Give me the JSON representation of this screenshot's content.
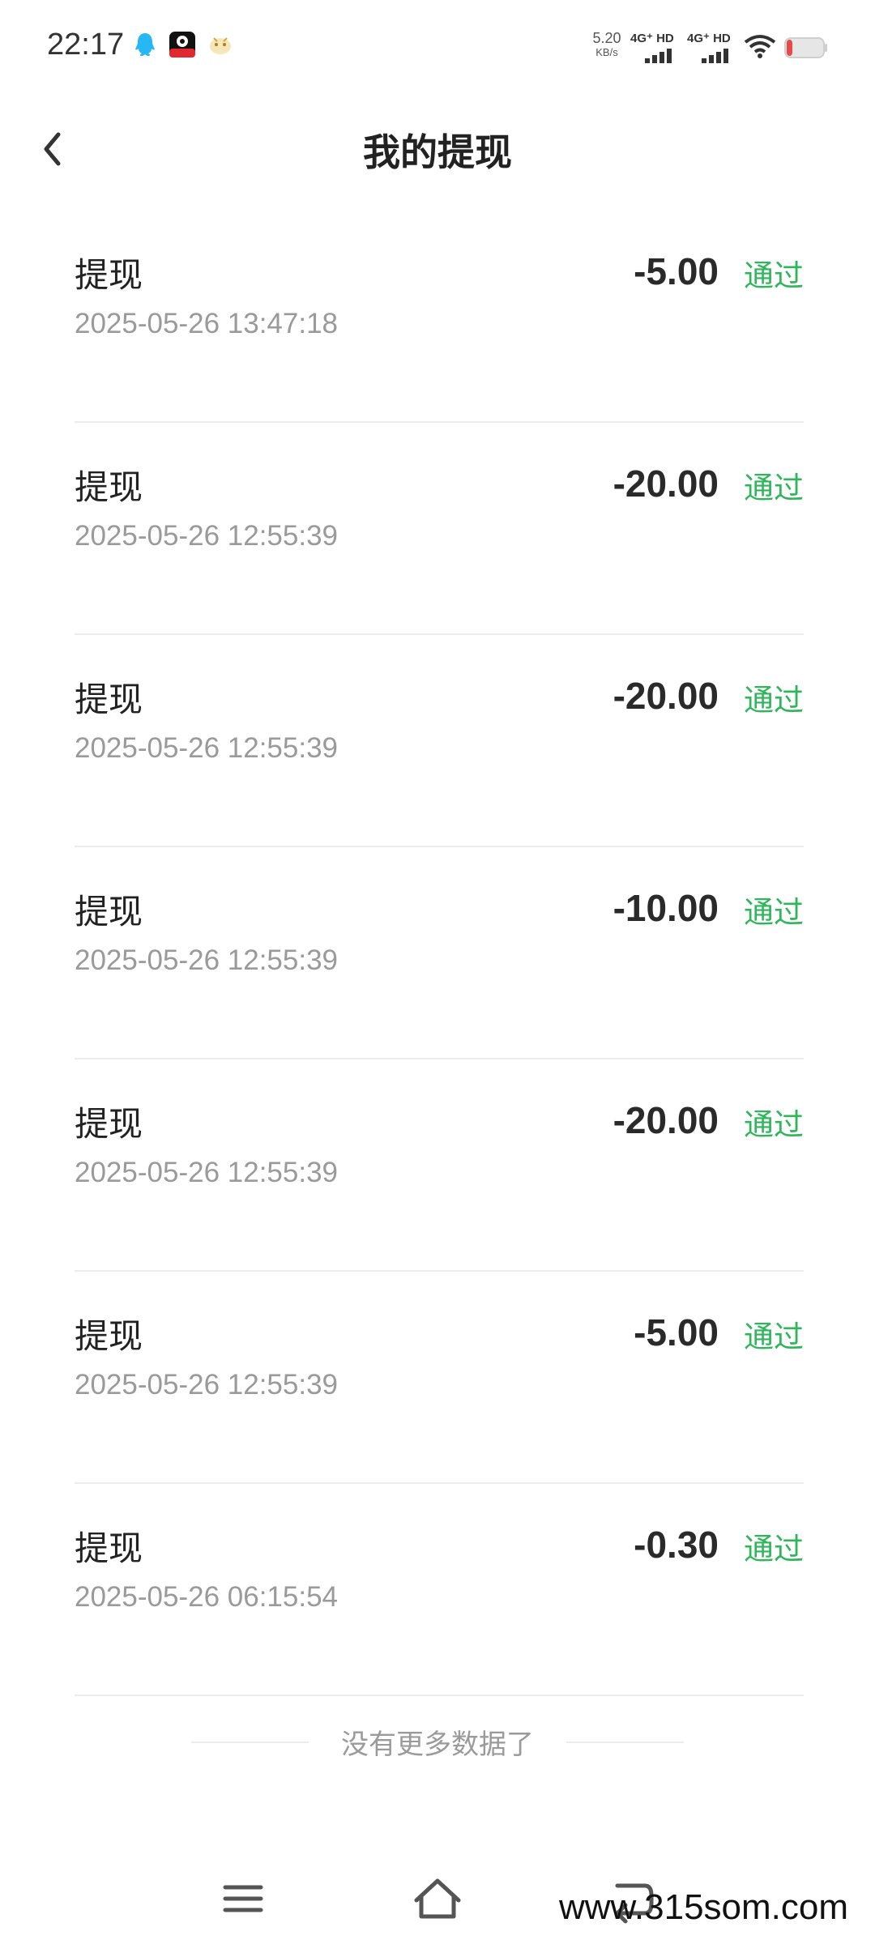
{
  "status_bar": {
    "time": "22:17",
    "net_speed_value": "5.20",
    "net_speed_unit": "KB/s",
    "signal1_label": "4G⁺ HD",
    "signal2_label": "4G⁺ HD",
    "icons": [
      "qq-icon",
      "app-icon",
      "app-icon-2",
      "signal-icon",
      "wifi-icon",
      "battery-icon"
    ],
    "battery_color": "#e84a4a"
  },
  "header": {
    "title": "我的提现",
    "back_icon": "chevron-left-icon"
  },
  "records": [
    {
      "title": "提现",
      "date": "2025-05-26 13:47:18",
      "amount": "-5.00",
      "status": "通过"
    },
    {
      "title": "提现",
      "date": "2025-05-26 12:55:39",
      "amount": "-20.00",
      "status": "通过"
    },
    {
      "title": "提现",
      "date": "2025-05-26 12:55:39",
      "amount": "-20.00",
      "status": "通过"
    },
    {
      "title": "提现",
      "date": "2025-05-26 12:55:39",
      "amount": "-10.00",
      "status": "通过"
    },
    {
      "title": "提现",
      "date": "2025-05-26 12:55:39",
      "amount": "-20.00",
      "status": "通过"
    },
    {
      "title": "提现",
      "date": "2025-05-26 12:55:39",
      "amount": "-5.00",
      "status": "通过"
    },
    {
      "title": "提现",
      "date": "2025-05-26 06:15:54",
      "amount": "-0.30",
      "status": "通过"
    }
  ],
  "end_hint": "没有更多数据了",
  "nav": {
    "icons": [
      "menu-icon",
      "home-icon",
      "back-icon"
    ]
  },
  "watermark": "www.315som.com",
  "colors": {
    "status_pass": "#2fb55a",
    "date_text": "#9a9a9a",
    "divider": "#ececec"
  }
}
